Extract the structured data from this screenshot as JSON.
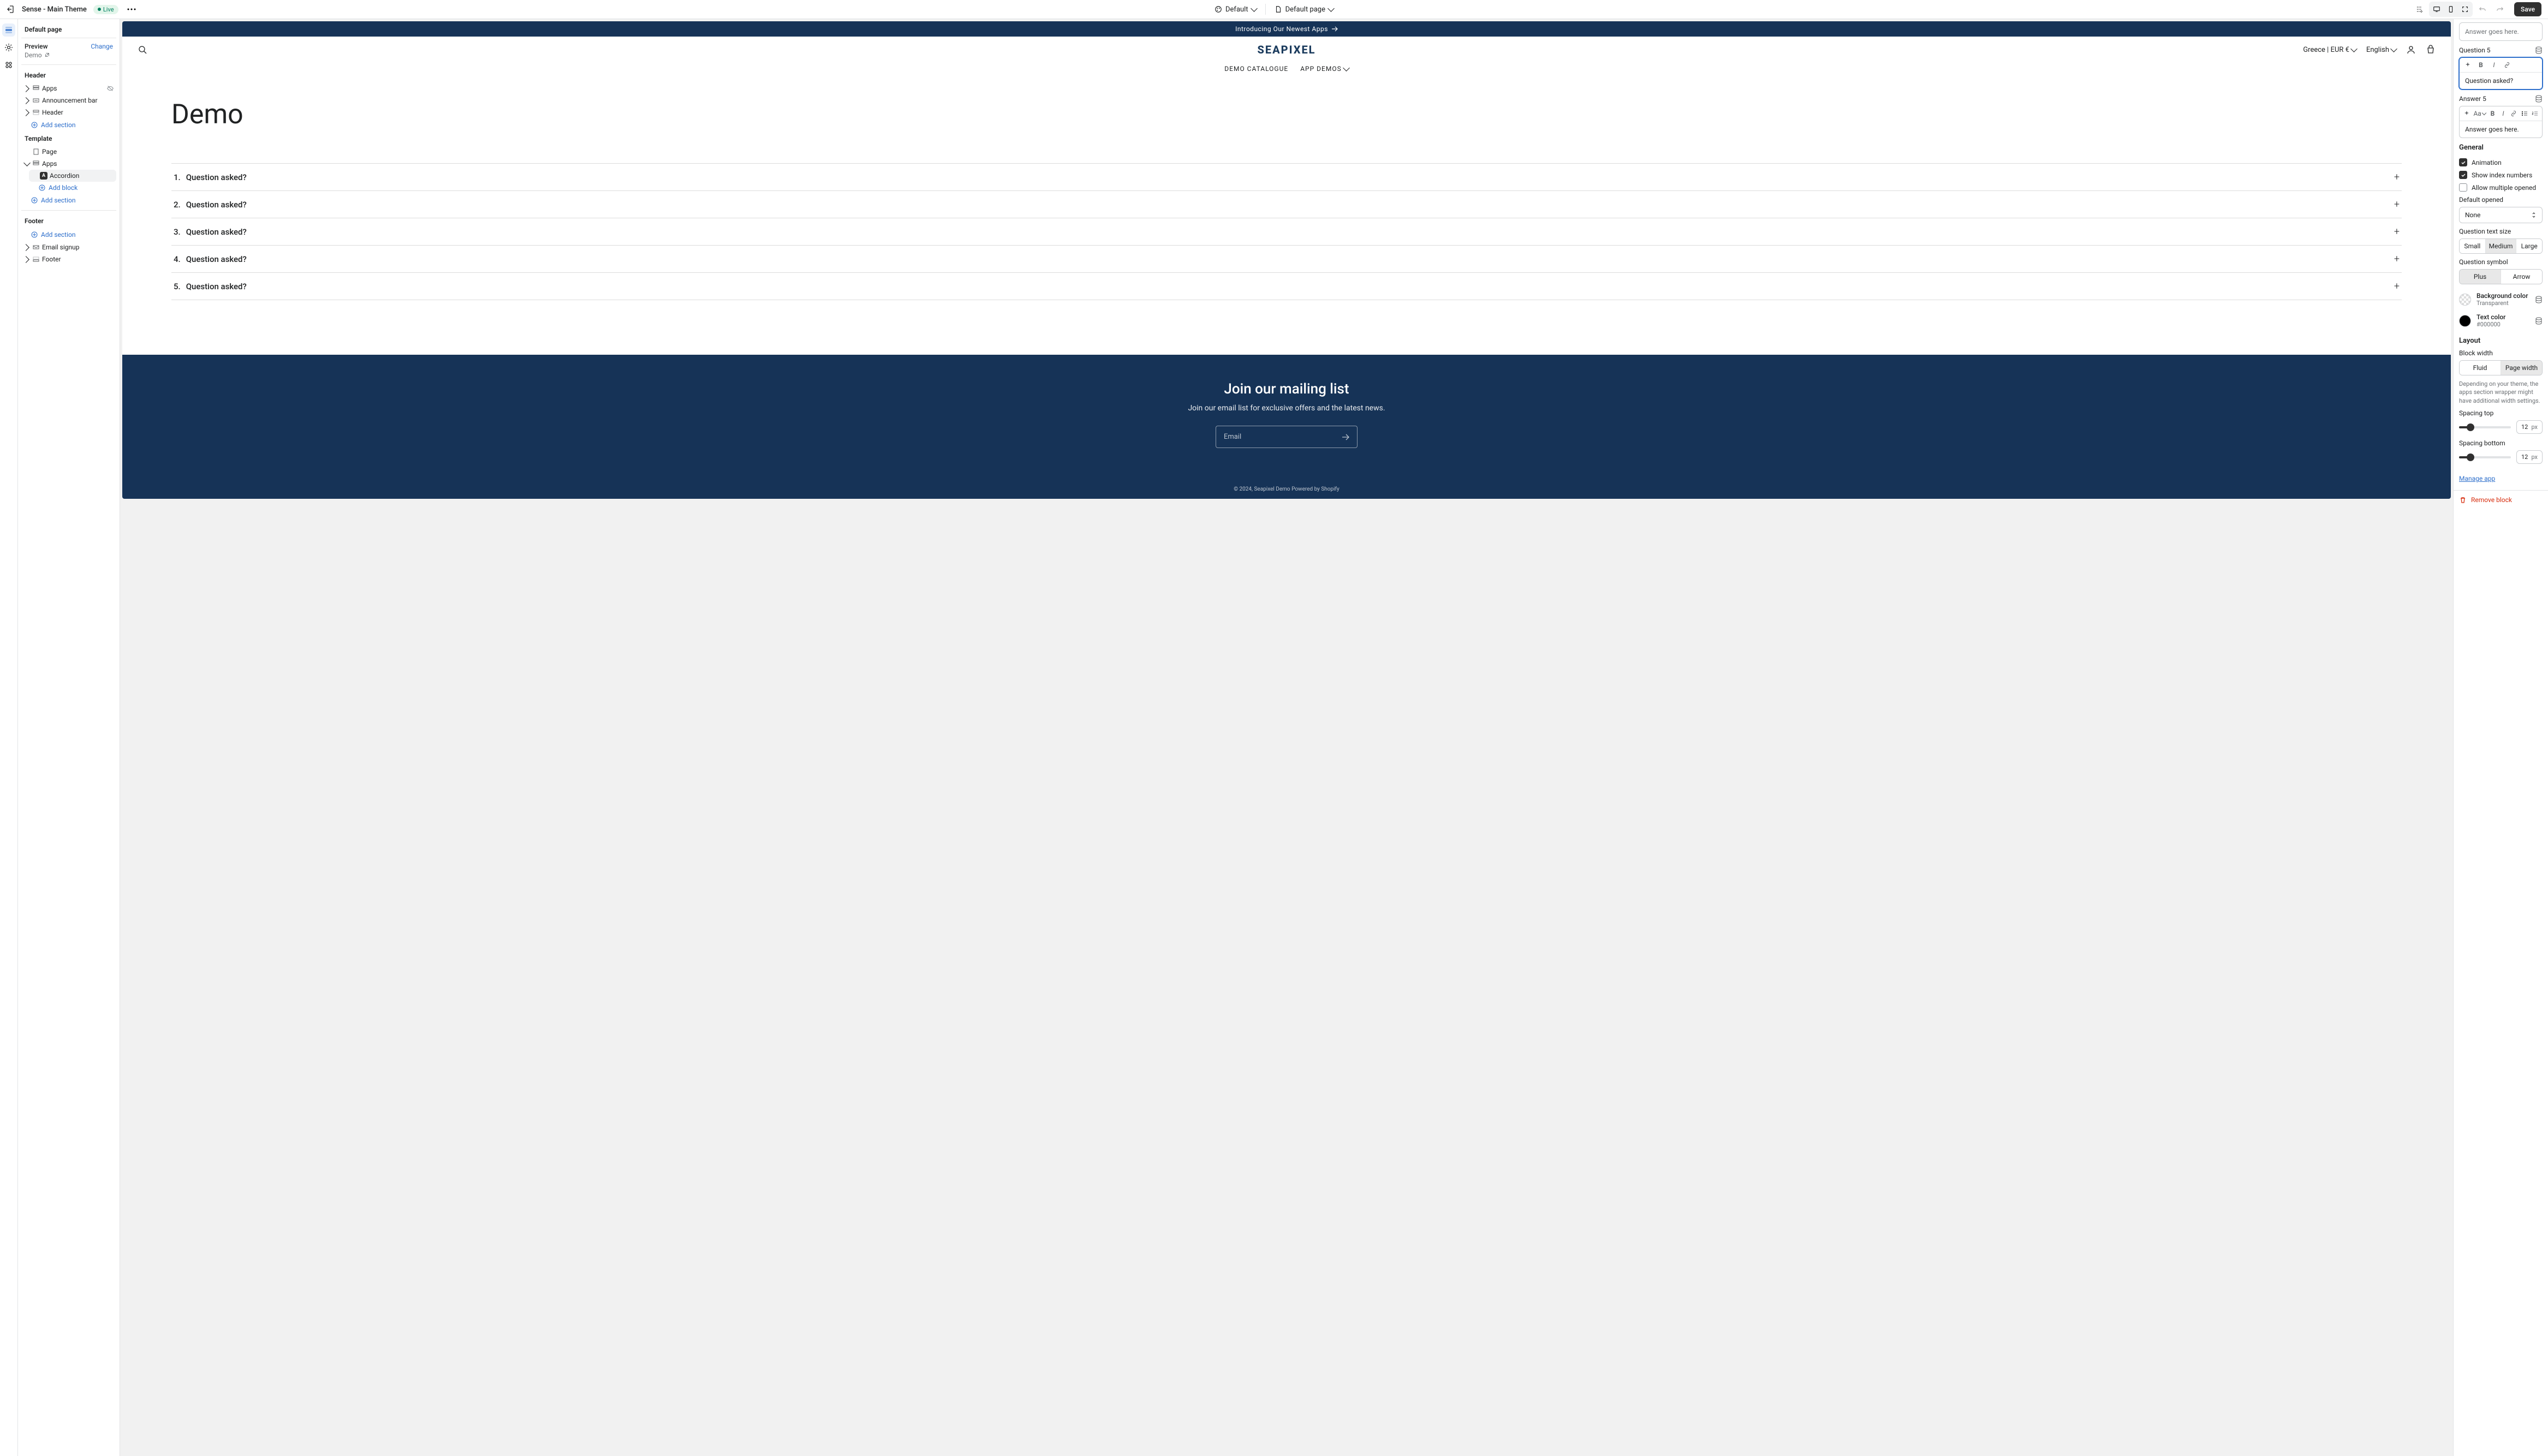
{
  "topbar": {
    "theme_name": "Sense - Main Theme",
    "status_badge": "Live",
    "scheme_label": "Default",
    "page_label": "Default page",
    "save": "Save"
  },
  "sidebar": {
    "title": "Default page",
    "preview_label": "Preview",
    "change": "Change",
    "preview_name": "Demo",
    "groups": {
      "header": {
        "label": "Header",
        "items": [
          {
            "label": "Apps",
            "hidden": true
          },
          {
            "label": "Announcement bar"
          },
          {
            "label": "Header"
          }
        ]
      },
      "template": {
        "label": "Template",
        "items": [
          {
            "label": "Page"
          },
          {
            "label": "Apps",
            "expanded": true,
            "blocks": [
              {
                "label": "Accordion",
                "selected": true
              }
            ]
          }
        ]
      },
      "footer": {
        "label": "Footer",
        "items": [
          {
            "label": "Email signup"
          },
          {
            "label": "Footer"
          }
        ]
      }
    },
    "add_section": "Add section",
    "add_block": "Add block"
  },
  "preview": {
    "announcement": "Introducing Our Newest Apps",
    "logo": "SEAPIXEL",
    "country": "Greece | EUR €",
    "language": "English",
    "nav": [
      {
        "label": "DEMO CATALOGUE"
      },
      {
        "label": "APP DEMOS",
        "dropdown": true
      }
    ],
    "page_title": "Demo",
    "accordion": [
      {
        "idx": "1.",
        "q": "Question asked?"
      },
      {
        "idx": "2.",
        "q": "Question asked?"
      },
      {
        "idx": "3.",
        "q": "Question asked?"
      },
      {
        "idx": "4.",
        "q": "Question asked?"
      },
      {
        "idx": "5.",
        "q": "Question asked?"
      }
    ],
    "footer": {
      "title": "Join our mailing list",
      "subtitle": "Join our email list for exclusive offers and the latest news.",
      "email_placeholder": "Email",
      "copyright": "© 2024, Seapixel Demo Powered by Shopify"
    }
  },
  "panel": {
    "answer4_value": "Answer goes here.",
    "q5_label": "Question 5",
    "q5_value": "Question asked?",
    "a5_label": "Answer 5",
    "a5_value": "Answer goes here.",
    "general_hdr": "General",
    "chk_animation": "Animation",
    "chk_index": "Show index numbers",
    "chk_multiple": "Allow multiple opened",
    "default_opened_lbl": "Default opened",
    "default_opened_val": "None",
    "q_text_size_lbl": "Question text size",
    "size_opts": [
      "Small",
      "Medium",
      "Large"
    ],
    "q_symbol_lbl": "Question symbol",
    "symbol_opts": [
      "Plus",
      "Arrow"
    ],
    "bg_color_lbl": "Background color",
    "bg_color_val": "Transparent",
    "text_color_lbl": "Text color",
    "text_color_val": "#000000",
    "layout_hdr": "Layout",
    "block_width_lbl": "Block width",
    "width_opts": [
      "Fluid",
      "Page width"
    ],
    "width_help": "Depending on your theme, the apps section wrapper might have additional width settings.",
    "spacing_top_lbl": "Spacing top",
    "spacing_top_val": "12",
    "spacing_bottom_lbl": "Spacing bottom",
    "spacing_bottom_val": "12",
    "px": "px",
    "manage_app": "Manage app",
    "remove_block": "Remove block"
  }
}
